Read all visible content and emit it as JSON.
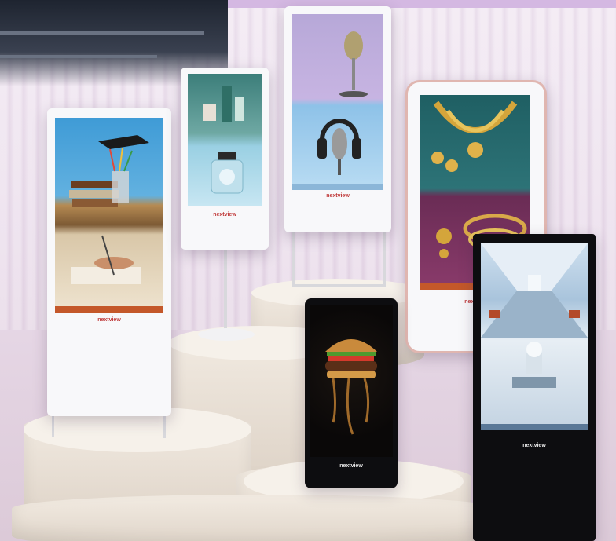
{
  "scene": {
    "description_colors": {
      "background": "#e9dbea",
      "podium": "#e6ddd2",
      "brand_red": "#c03a3a"
    }
  },
  "displays": [
    {
      "name": "education-kiosk",
      "brand": "nextview",
      "frame": "white"
    },
    {
      "name": "perfume-kiosk",
      "brand": "nextview",
      "frame": "white"
    },
    {
      "name": "microphone-kiosk",
      "brand": "nextview",
      "frame": "white"
    },
    {
      "name": "jewelry-kiosk",
      "brand": "nextview",
      "frame": "white"
    },
    {
      "name": "burger-kiosk",
      "brand": "nextview",
      "frame": "black"
    },
    {
      "name": "hospital-kiosk",
      "brand": "nextview",
      "frame": "black"
    }
  ]
}
